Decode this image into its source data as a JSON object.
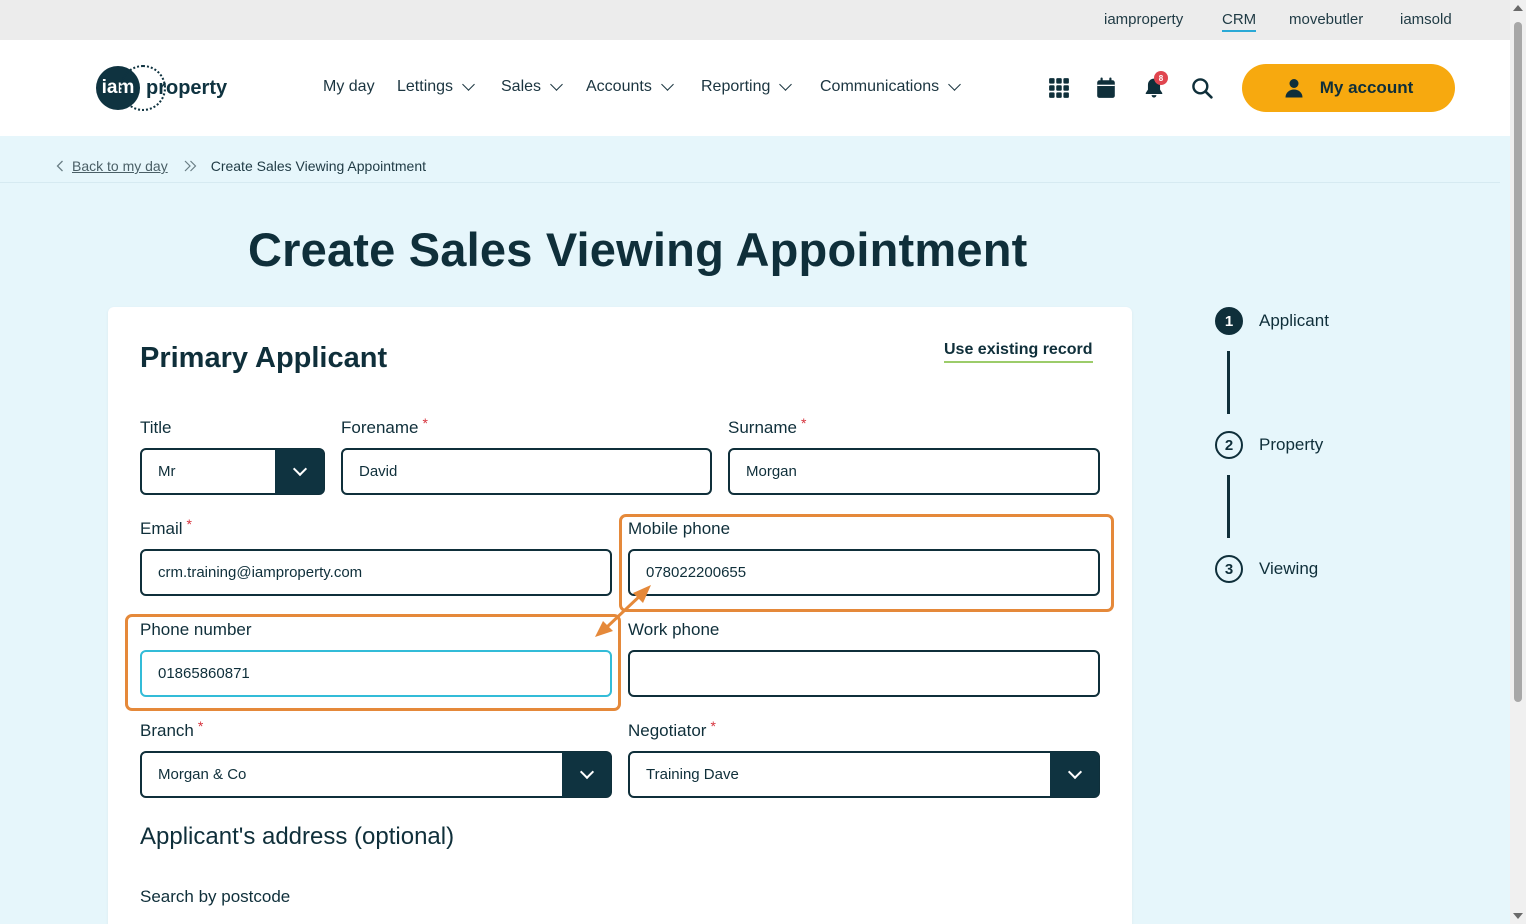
{
  "topbar": {
    "links": [
      "iamproperty",
      "CRM",
      "movebutler",
      "iamsold"
    ],
    "active": "CRM"
  },
  "header": {
    "logo_badge": "iam",
    "logo_word": "property",
    "nav": [
      "My day",
      "Lettings",
      "Sales",
      "Accounts",
      "Reporting",
      "Communications"
    ],
    "icons": [
      "apps-grid-icon",
      "calendar-icon",
      "bell-icon",
      "search-icon"
    ],
    "notification_count": "8",
    "account_label": "My account"
  },
  "breadcrumb": {
    "back": "Back to my day",
    "current": "Create Sales Viewing Appointment"
  },
  "page": {
    "title": "Create Sales Viewing Appointment"
  },
  "form": {
    "heading": "Primary Applicant",
    "use_existing": "Use existing record",
    "title_label": "Title",
    "title_value": "Mr",
    "forename_label": "Forename",
    "forename_value": "David",
    "surname_label": "Surname",
    "surname_value": "Morgan",
    "email_label": "Email",
    "email_value": "crm.training@iamproperty.com",
    "mobile_label": "Mobile phone",
    "mobile_value": "078022200655",
    "phone_label": "Phone number",
    "phone_value": "01865860871",
    "work_label": "Work phone",
    "work_value": "",
    "branch_label": "Branch",
    "branch_value": "Morgan & Co",
    "negotiator_label": "Negotiator",
    "negotiator_value": "Training Dave",
    "address_heading": "Applicant's address (optional)",
    "postcode_label": "Search by postcode",
    "required_mark": "*"
  },
  "stepper": {
    "steps": [
      {
        "num": "1",
        "label": "Applicant"
      },
      {
        "num": "2",
        "label": "Property"
      },
      {
        "num": "3",
        "label": "Viewing"
      }
    ]
  },
  "colors": {
    "primary": "#0f2f3a",
    "accent": "#f7a90f",
    "background": "#e6f6fb",
    "annotation": "#e5893a",
    "focus": "#33bcd8",
    "required": "#d6323c"
  }
}
